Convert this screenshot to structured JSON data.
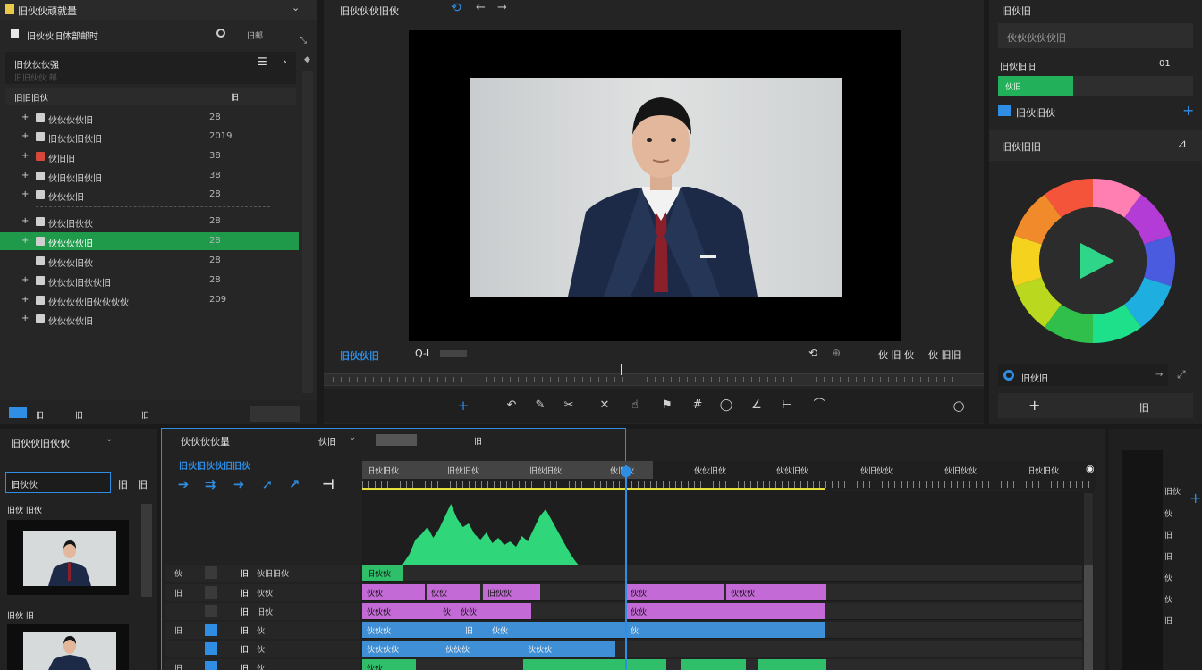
{
  "project": {
    "title": "旧伙伙顽就量",
    "toolbar_label": "旧伙伙旧体部邮时",
    "toolbar_right": "旧邮",
    "bin_title": "旧伙伙伙强",
    "bin_sub": "旧旧伙伙 邮",
    "list_header": "旧旧旧伙",
    "list_header_val": "旧",
    "items": [
      {
        "label": "伙伙伙伙旧",
        "value": "28"
      },
      {
        "label": "旧伙伙旧伙旧",
        "value": "2019"
      },
      {
        "label": "伙旧旧",
        "value": "38"
      },
      {
        "label": "伙旧伙旧伙旧",
        "value": "38"
      },
      {
        "label": "伙伙伙旧",
        "value": "28"
      },
      {
        "label": "伙伙旧伙伙",
        "value": "28"
      },
      {
        "label": "伙伙伙伙旧",
        "value": "28"
      },
      {
        "label": "伙伙伙旧伙",
        "value": "28"
      },
      {
        "label": "伙伙伙旧伙伙旧",
        "value": "28"
      },
      {
        "label": "伙伙伙伙旧伙伙伙伙",
        "value": "209"
      },
      {
        "label": "伙伙伙伙旧",
        "value": ""
      }
    ],
    "footer_a": "旧",
    "footer_b": "旧",
    "footer_c": "旧"
  },
  "viewer": {
    "title": "旧伙伙伙旧伙",
    "timecode": "旧伙伙旧",
    "zoom": "Q-I",
    "fit_label": "伙 旧 伙",
    "ctrl_right": "伙 旧旧"
  },
  "color_panel": {
    "title": "旧伙旧",
    "field1": "伙伙伙伙伙旧",
    "row_label": "旧伙旧旧",
    "row_value": "01",
    "bar_label": "伙旧",
    "section_label": "旧伙旧伙",
    "wheel_title": "旧伙旧旧",
    "preset_label": "旧伙旧",
    "btn_add": "+",
    "btn_right": "旧",
    "wheel_colors": [
      "#ff7fb3",
      "#b33bd6",
      "#4a5be0",
      "#1faee0",
      "#1ee08a",
      "#2fbf4a",
      "#b9d81e",
      "#f4d21e",
      "#f08a2a",
      "#f4553a"
    ],
    "play_color": "#2fd68a"
  },
  "media": {
    "title": "旧伙伙旧伙伙",
    "search_value": "旧伙伙",
    "tab_b": "旧",
    "tab_c": "旧",
    "clip1": "旧伙 旧伙",
    "clip2": "旧伙 旧"
  },
  "timeline": {
    "title": "伙伙伙伙量",
    "dropdown": "伙旧",
    "tag": "旧",
    "effects_label": "旧伙旧伙伙旧旧伙",
    "ruler": [
      "旧伙旧伙",
      "旧伙旧伙",
      "旧伙旧伙",
      "伙旧伙",
      "伙伙旧伙",
      "伙伙旧伙",
      "伙旧伙伙",
      "伙旧伙伙",
      "旧伙旧伙"
    ],
    "tracks": [
      {
        "h1": "伙",
        "h2": "旧",
        "h3": "伙旧旧伙"
      },
      {
        "h1": "旧",
        "h2": "旧",
        "h3": "伙伙"
      },
      {
        "h1": "",
        "h2": "旧",
        "h3": "旧伙"
      },
      {
        "h1": "旧",
        "h2": "旧",
        "h3": "伙"
      },
      {
        "h1": "",
        "h2": "旧",
        "h3": "伙"
      },
      {
        "h1": "旧",
        "h2": "旧",
        "h3": "伙"
      }
    ],
    "clips_pink1": [
      "伙伙",
      "伙伙",
      "旧伙伙",
      "伙伙",
      "伙伙伙"
    ],
    "clips_pink2": [
      "伙伙伙",
      "伙",
      "伙伙",
      "伙伙"
    ],
    "clips_blue1": [
      "伙伙伙",
      "旧",
      "伙伙",
      "伙"
    ],
    "clips_blue2": [
      "伙伙伙伙",
      "伙伙伙",
      "伙伙伙"
    ],
    "clips_green": [
      "伙伙"
    ],
    "wave_label": "旧伙伙"
  },
  "right_side": {
    "labels": [
      "旧伙",
      "伙",
      "旧",
      "旧",
      "伙",
      "伙",
      "旧"
    ]
  }
}
